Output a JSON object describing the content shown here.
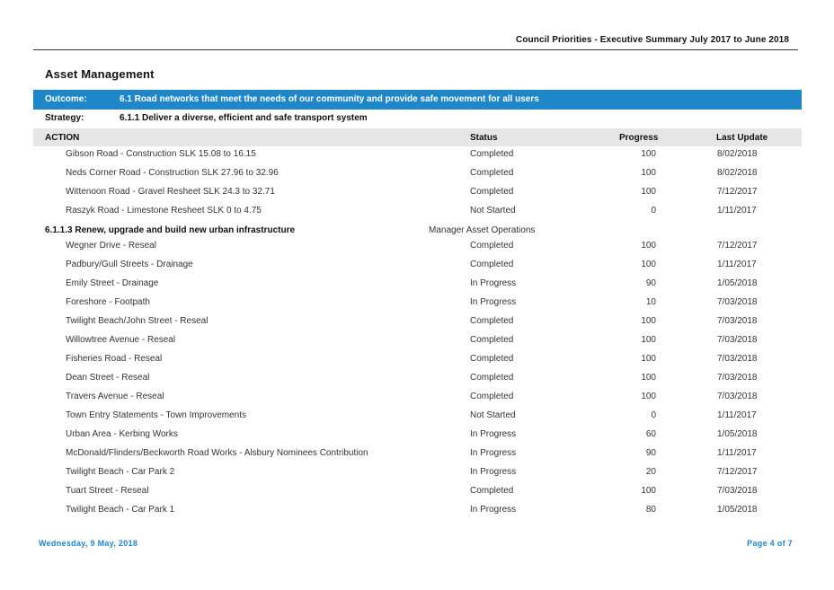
{
  "header": {
    "title": "Council Priorities - Executive Summary  July 2017 to June 2018"
  },
  "section": {
    "title": "Asset Management"
  },
  "outcome": {
    "label": "Outcome:",
    "value": "6.1  Road networks that meet the needs of our community and provide safe movement for all users"
  },
  "strategy": {
    "label": "Strategy:",
    "value": "6.1.1  Deliver a diverse, efficient and safe transport system"
  },
  "columns": {
    "action": "ACTION",
    "status": "Status",
    "progress": "Progress",
    "last_update": "Last Update"
  },
  "group1": {
    "rows": [
      {
        "action": "Gibson Road - Construction SLK 15.08 to 16.15",
        "status": "Completed",
        "progress": "100",
        "date": "8/02/2018"
      },
      {
        "action": "Neds Corner Road - Construction SLK 27.96 to 32.96",
        "status": "Completed",
        "progress": "100",
        "date": "8/02/2018"
      },
      {
        "action": "Wittenoon Road - Gravel Resheet SLK 24.3 to 32.71",
        "status": "Completed",
        "progress": "100",
        "date": "7/12/2017"
      },
      {
        "action": "Raszyk Road - Limestone Resheet SLK 0 to 4.75",
        "status": "Not Started",
        "progress": "0",
        "date": "1/11/2017"
      }
    ]
  },
  "group2": {
    "code": "6.1.1.3  Renew, upgrade and build new urban infrastructure",
    "manager": "Manager Asset Operations",
    "rows": [
      {
        "action": "Wegner Drive - Reseal",
        "status": "Completed",
        "progress": "100",
        "date": "7/12/2017"
      },
      {
        "action": "Padbury/Gull Streets - Drainage",
        "status": "Completed",
        "progress": "100",
        "date": "1/11/2017"
      },
      {
        "action": "Emily Street - Drainage",
        "status": "In Progress",
        "progress": "90",
        "date": "1/05/2018"
      },
      {
        "action": "Foreshore - Footpath",
        "status": "In Progress",
        "progress": "10",
        "date": "7/03/2018"
      },
      {
        "action": "Twilight Beach/John Street - Reseal",
        "status": "Completed",
        "progress": "100",
        "date": "7/03/2018"
      },
      {
        "action": "Willowtree Avenue - Reseal",
        "status": "Completed",
        "progress": "100",
        "date": "7/03/2018"
      },
      {
        "action": "Fisheries Road - Reseal",
        "status": "Completed",
        "progress": "100",
        "date": "7/03/2018"
      },
      {
        "action": "Dean Street - Reseal",
        "status": "Completed",
        "progress": "100",
        "date": "7/03/2018"
      },
      {
        "action": "Travers Avenue - Reseal",
        "status": "Completed",
        "progress": "100",
        "date": "7/03/2018"
      },
      {
        "action": "Town Entry Statements - Town Improvements",
        "status": "Not Started",
        "progress": "0",
        "date": "1/11/2017"
      },
      {
        "action": "Urban Area - Kerbing Works",
        "status": "In Progress",
        "progress": "60",
        "date": "1/05/2018"
      },
      {
        "action": "McDonald/Flinders/Beckworth Road Works - Alsbury Nominees Contribution",
        "status": "In Progress",
        "progress": "90",
        "date": "1/11/2017"
      },
      {
        "action": "Twilight Beach - Car Park 2",
        "status": "In Progress",
        "progress": "20",
        "date": "7/12/2017"
      },
      {
        "action": "Tuart Street - Reseal",
        "status": "Completed",
        "progress": "100",
        "date": "7/03/2018"
      },
      {
        "action": "Twilight Beach - Car Park 1",
        "status": "In Progress",
        "progress": "80",
        "date": "1/05/2018"
      }
    ]
  },
  "footer": {
    "date": "Wednesday, 9 May, 2018",
    "page": "Page 4 of 7"
  }
}
